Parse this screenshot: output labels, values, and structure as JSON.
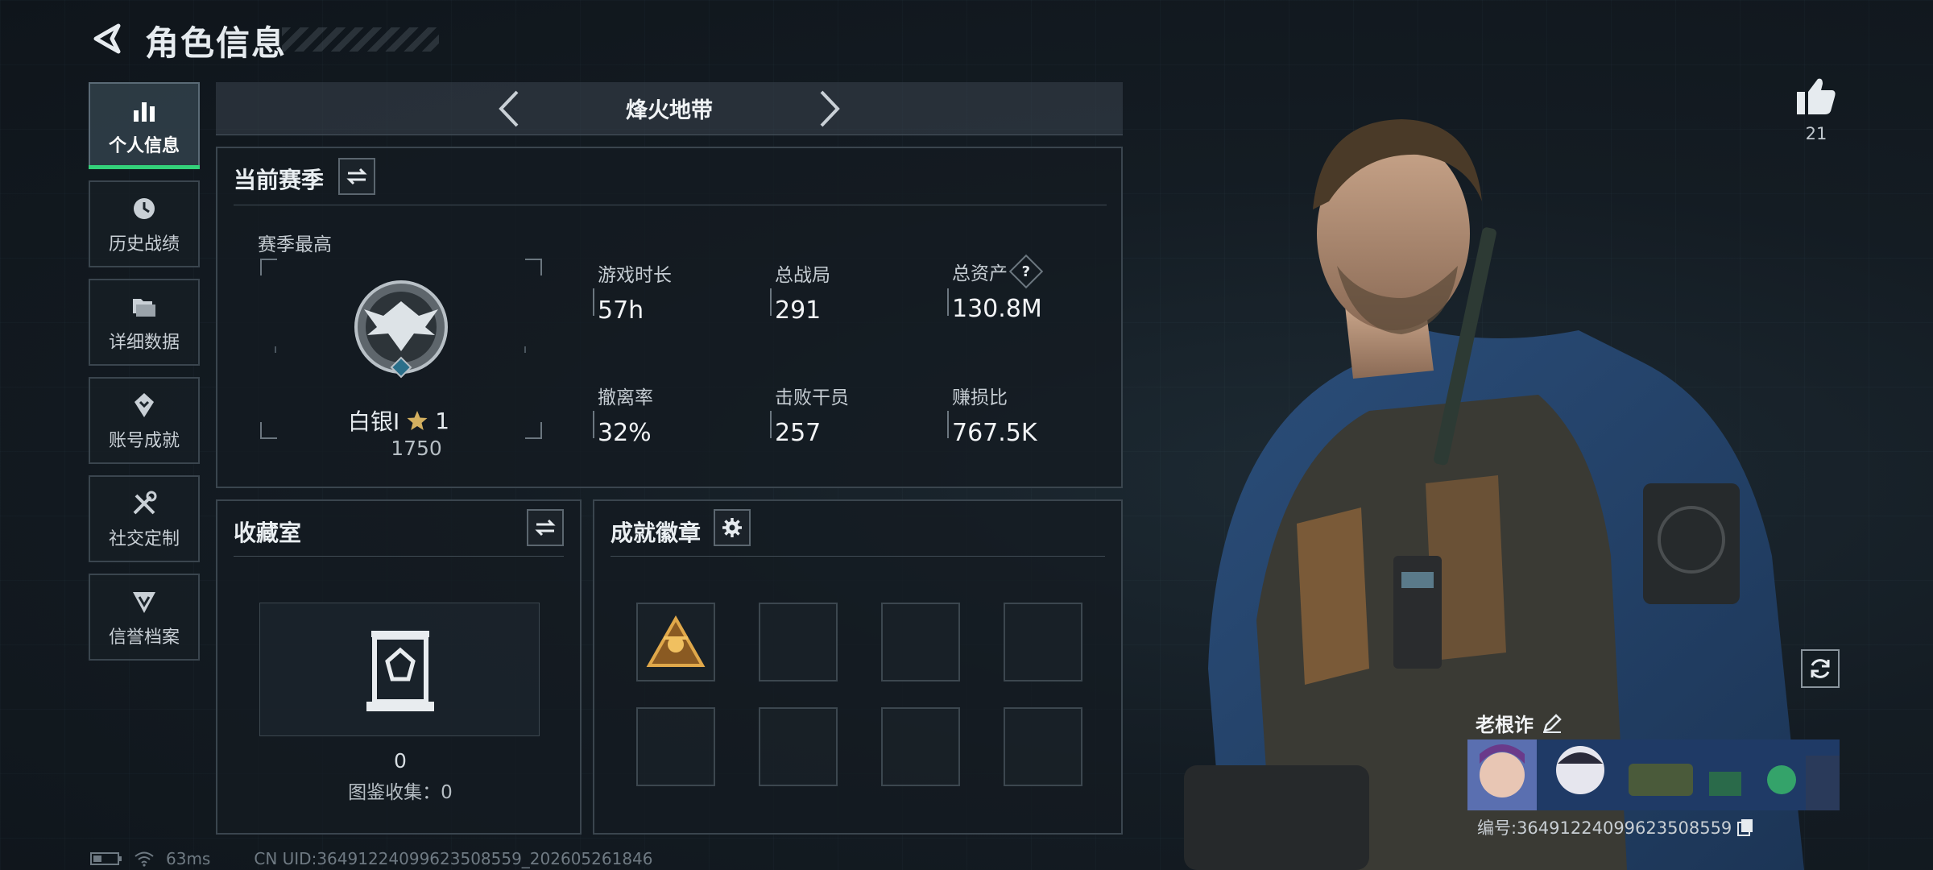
{
  "header": {
    "title": "角色信息"
  },
  "sidebar": {
    "items": [
      {
        "label": "个人信息",
        "icon": "bar-chart-icon",
        "active": true
      },
      {
        "label": "历史战绩",
        "icon": "clock-history-icon",
        "active": false
      },
      {
        "label": "详细数据",
        "icon": "folders-icon",
        "active": false
      },
      {
        "label": "账号成就",
        "icon": "achievement-medal-icon",
        "active": false
      },
      {
        "label": "社交定制",
        "icon": "tools-icon",
        "active": false
      },
      {
        "label": "信誉档案",
        "icon": "credit-emblem-icon",
        "active": false
      }
    ]
  },
  "mode": {
    "name": "烽火地带"
  },
  "season": {
    "title": "当前赛季",
    "best_label": "赛季最高",
    "rank_name": "白银I",
    "rank_stars": "1",
    "rank_score": "1750",
    "stats": [
      {
        "label": "游戏时长",
        "value": "57h"
      },
      {
        "label": "总战局",
        "value": "291"
      },
      {
        "label": "总资产",
        "value": "130.8M",
        "help": "?"
      },
      {
        "label": "撤离率",
        "value": "32%"
      },
      {
        "label": "击败干员",
        "value": "257"
      },
      {
        "label": "赚损比",
        "value": "767.5K"
      }
    ]
  },
  "collection": {
    "title": "收藏室",
    "count": "0",
    "catalog_label": "图鉴收集：0"
  },
  "badges": {
    "title": "成就徽章",
    "slots_total": 8,
    "filled_slots": 1
  },
  "profile": {
    "likes": "21",
    "nickname": "老根诈",
    "id_label": "编号:3649122409962350855​9"
  },
  "footer": {
    "ping": "63ms",
    "uid": "CN UID:3649122409962350855​9_202605261846"
  },
  "colors": {
    "accent": "#33d17a",
    "panel_border": "#3a454e",
    "gold": "#c99a3c"
  }
}
